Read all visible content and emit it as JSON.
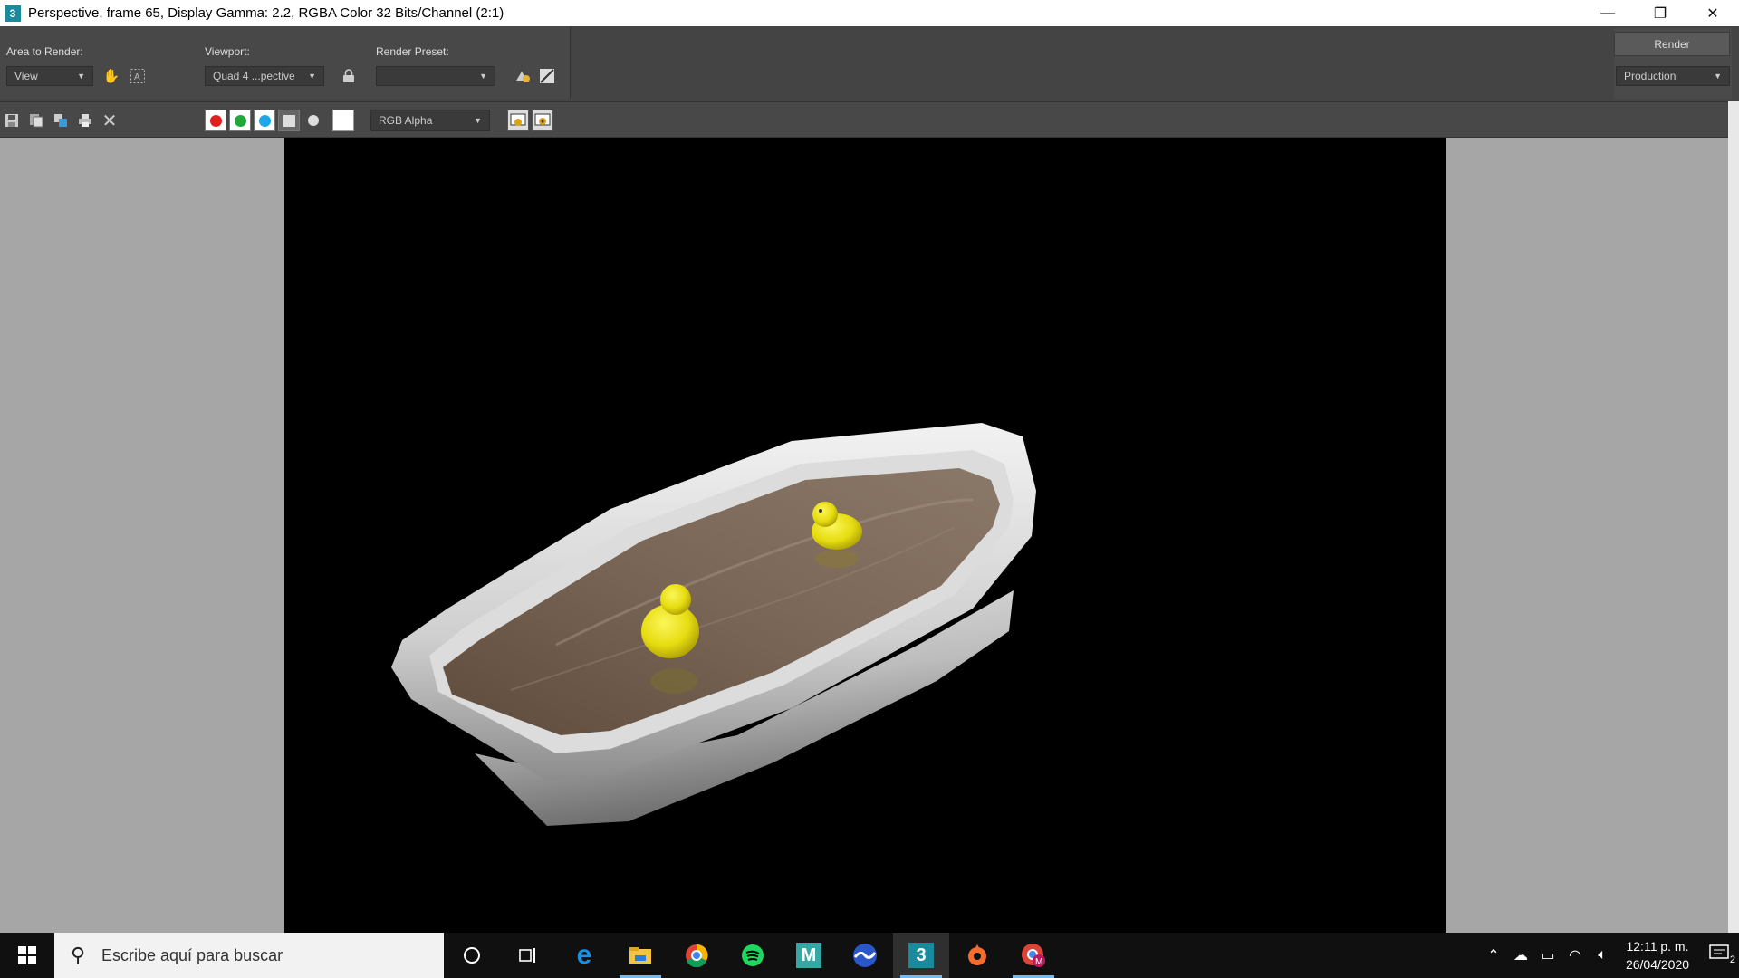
{
  "window": {
    "title": "Perspective, frame 65, Display Gamma: 2.2, RGBA Color 32 Bits/Channel (2:1)",
    "app_icon_glyph": "3",
    "minimize": "—",
    "restore": "❐",
    "close": "✕"
  },
  "render_toolbar": {
    "area_label": "Area to Render:",
    "area_value": "View",
    "viewport_label": "Viewport:",
    "viewport_value": "Quad 4 ...pective",
    "preset_label": "Render Preset:",
    "preset_value": "",
    "render_button": "Render",
    "mode_value": "Production"
  },
  "frame_toolbar": {
    "channel_value": "RGB Alpha",
    "channel_colors": {
      "red": "#e0201e",
      "green": "#22a83a",
      "blue": "#1ea7e8"
    }
  },
  "taskbar": {
    "search_placeholder": "Escribe aquí para buscar",
    "apps": [
      "cortana-icon",
      "task-view-icon",
      "edge-icon",
      "file-explorer-icon",
      "chrome-icon",
      "spotify-icon",
      "maya-icon",
      "app-wave-icon",
      "3dsmax-icon",
      "origin-icon",
      "chrome-profile-icon"
    ],
    "active_app": "3dsmax-icon",
    "time": "12:11 p. m.",
    "date": "26/04/2020",
    "notification_count": "2",
    "maya_label": "M",
    "max_label": "3"
  }
}
